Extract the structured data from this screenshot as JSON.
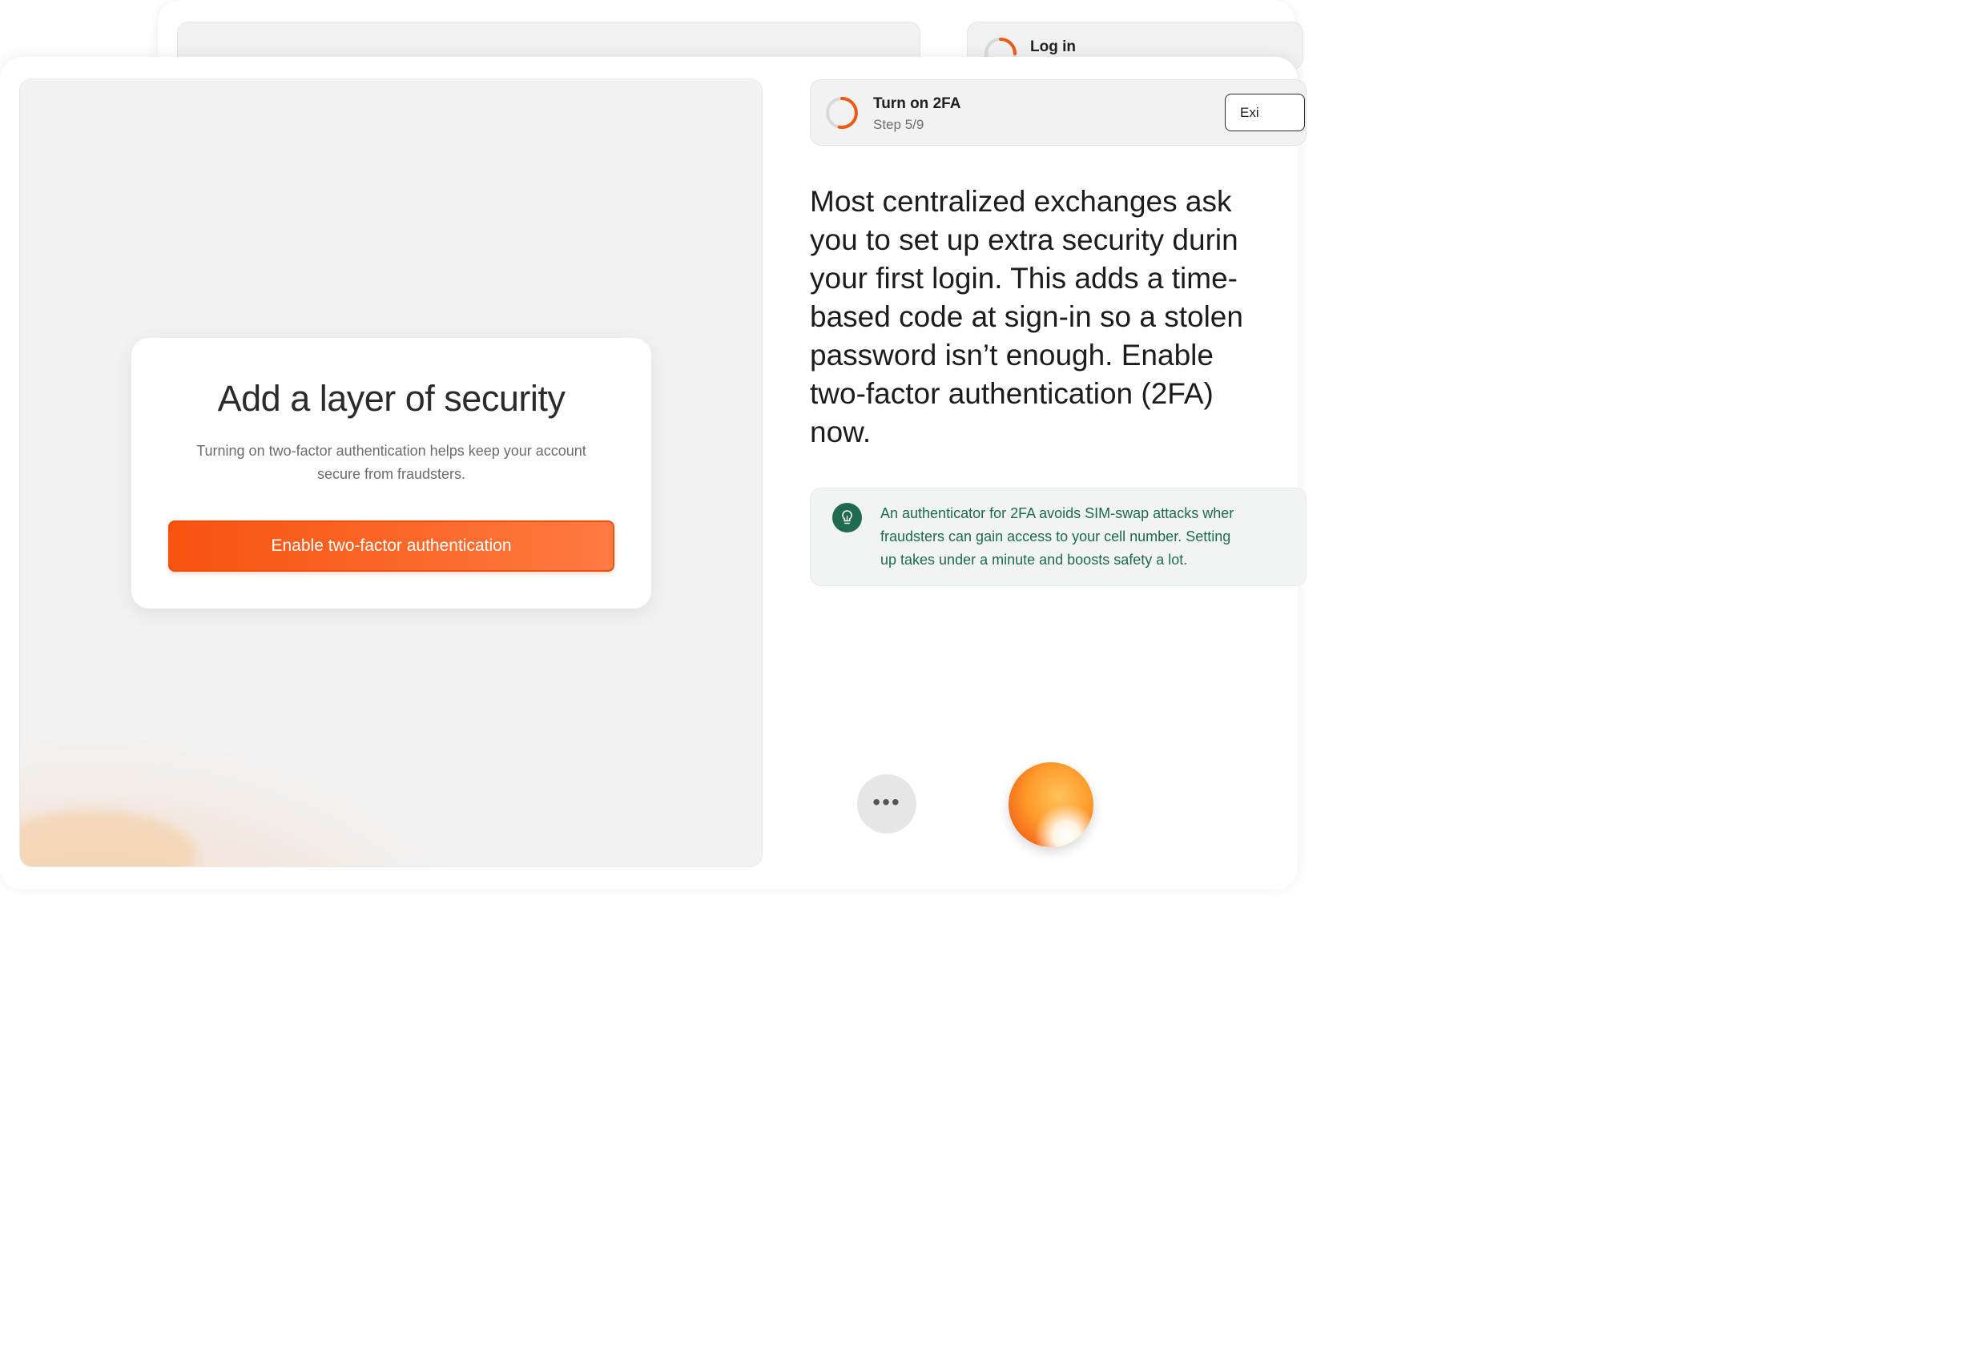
{
  "back_window": {
    "step_title": "Log in"
  },
  "preview": {
    "card": {
      "heading": "Add a layer of security",
      "description": "Turning on two-factor authentication helps keep your account secure from fraudsters.",
      "cta_label": "Enable two-factor authentication"
    }
  },
  "step_header": {
    "title": "Turn on 2FA",
    "step_label": "Step 5/9",
    "progress": {
      "current": 5,
      "total": 9
    },
    "exit_label": "Exi"
  },
  "instruction": {
    "text": "Most centralized exchanges ask\nyou to set up extra security durin\nyour first login. This adds a time-\nbased code at sign-in so a stolen\npassword isn’t enough. Enable\ntwo-factor authentication (2FA)\nnow."
  },
  "tip": {
    "icon": "lightbulb-icon",
    "text": "An authenticator for 2FA avoids SIM-swap attacks wher\nfraudsters can gain access to your cell number. Setting\nup takes under a minute and boosts safety a lot."
  },
  "controls": {
    "more_icon": "more-dots-icon",
    "more_label": "•••"
  },
  "colors": {
    "accent": "#f7530f",
    "progress_ring": "#f05a14",
    "tip_text": "#1d6a4f",
    "tip_icon_bg": "#1f6b50"
  }
}
